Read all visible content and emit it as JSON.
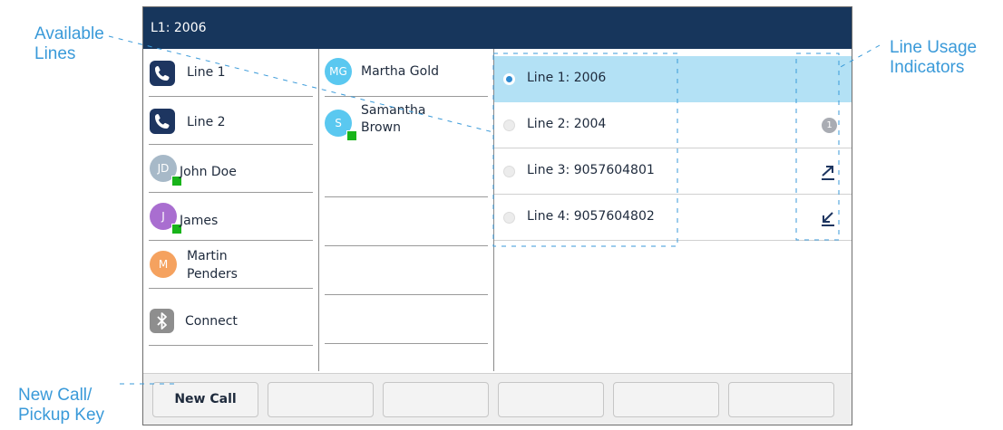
{
  "annotations": {
    "available_lines": "Available\nLines",
    "line_usage": "Line Usage\nIndicators",
    "new_call": "New Call/\nPickup Key"
  },
  "screen": {
    "title": "L1: 2006",
    "column1": [
      {
        "type": "line",
        "label": "Line 1",
        "icon": "phone-icon"
      },
      {
        "type": "line",
        "label": "Line 2",
        "icon": "phone-icon"
      },
      {
        "type": "contact",
        "label": "John Doe",
        "initials": "JD",
        "color": "#a7b9c8",
        "presence": true
      },
      {
        "type": "contact",
        "label": "James",
        "initials": "J",
        "color": "#a96ed0",
        "presence": true
      },
      {
        "type": "contact",
        "label": "Martin\nPenders",
        "initials": "M",
        "color": "#f5a25f",
        "presence": false
      },
      {
        "type": "bluetooth",
        "label": "Connect",
        "icon": "bluetooth-icon"
      }
    ],
    "column2": [
      {
        "label": "Martha Gold",
        "initials": "MG",
        "color": "#5ac8f0",
        "presence": false
      },
      {
        "label": "Samantha\nBrown",
        "initials": "S",
        "color": "#5ac8f0",
        "presence": true
      }
    ],
    "lines": [
      {
        "label": "Line 1: 2006",
        "selected": true,
        "indicator": "none"
      },
      {
        "label": "Line 2: 2004",
        "selected": false,
        "indicator": "1"
      },
      {
        "label": "Line 3: 9057604801",
        "selected": false,
        "indicator": "outgoing-call-icon"
      },
      {
        "label": "Line 4: 9057604802",
        "selected": false,
        "indicator": "incoming-call-icon"
      }
    ],
    "softkeys": [
      "New Call",
      "",
      "",
      "",
      "",
      ""
    ]
  },
  "colors": {
    "title_bar": "#17365c",
    "selected_line": "#b3e1f5",
    "annotation": "#3a9ad9",
    "presence": "#18b41a"
  }
}
